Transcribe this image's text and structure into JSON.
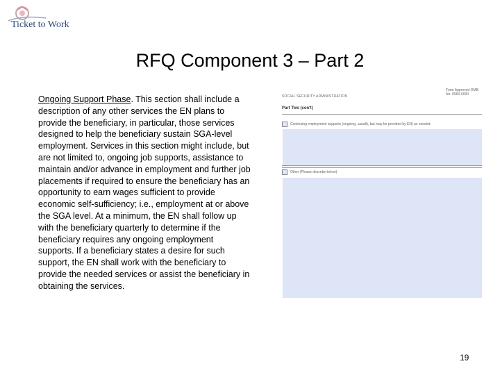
{
  "logo": {
    "text": "Ticket to Work"
  },
  "title": "RFQ Component 3 – Part 2",
  "body": {
    "lead": "Ongoing Support Phase",
    "text": ". This section shall include a description of any other services the EN plans to provide the beneficiary, in particular, those services designed to help the beneficiary sustain SGA-level employment. Services in this section might include, but are not limited to, ongoing job supports, assistance to maintain and/or advance in employment and further job placements if required to ensure the beneficiary has an opportunity to earn wages sufficient to provide economic self-sufficiency; i.e., employment at or above the SGA level. At a minimum, the EN shall follow up with the beneficiary quarterly to determine if the beneficiary requires any ongoing employment supports. If a beneficiary states a desire for such support, the EN shall work with the beneficiary to provide the needed services or assist the beneficiary in obtaining the services."
  },
  "form": {
    "header": "SOCIAL SECURITY ADMINISTRATION",
    "approval": "Form Approved OMB No. 0960-0000",
    "section": "Part Two (con't)",
    "items": [
      {
        "label": "Continuing employment supports (ongoing, usually, but may be provided by EN) as needed."
      },
      {
        "label": "Other (Please describe below)"
      }
    ]
  },
  "page_number": "19",
  "colors": {
    "field_fill": "#dde5f7",
    "logo_text": "#2e4a7a"
  }
}
